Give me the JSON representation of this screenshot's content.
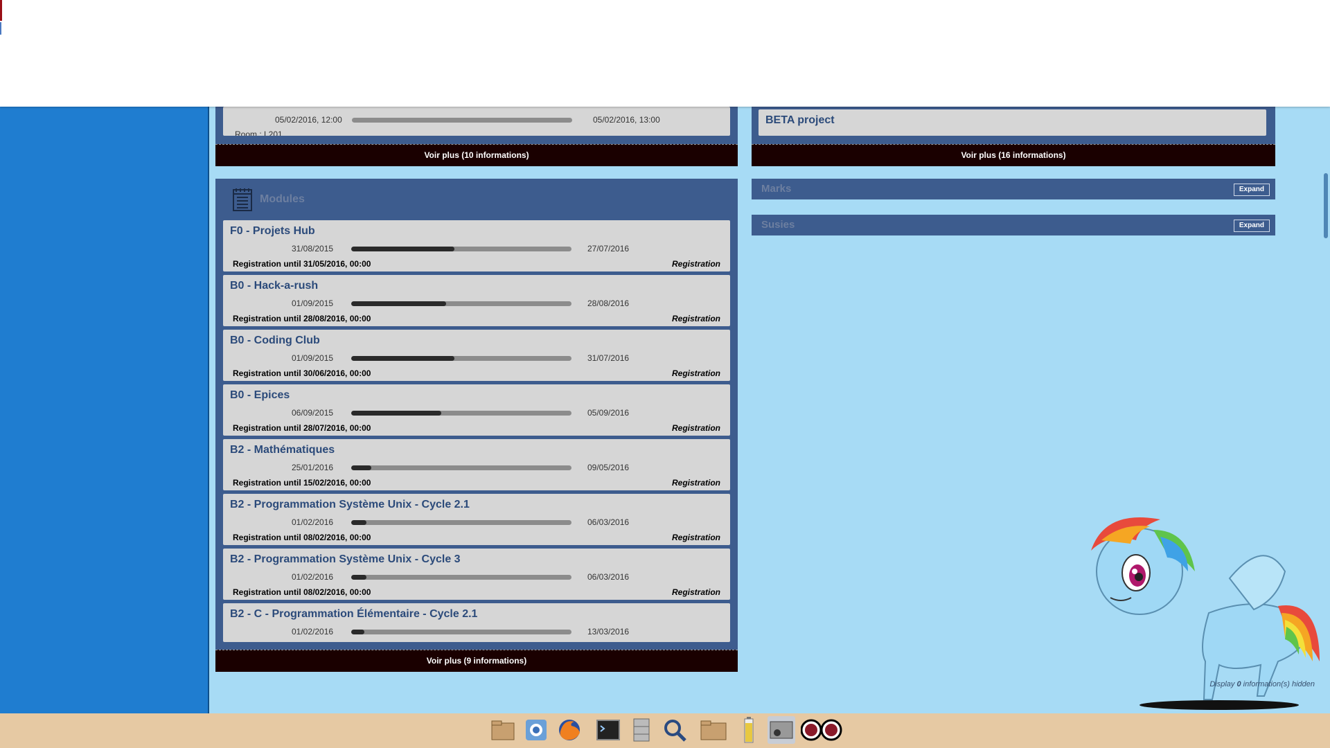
{
  "top_left_card": {
    "start": "05/02/2016, 12:00",
    "end": "05/02/2016, 13:00",
    "room": "Room : L201",
    "progress": 0.0
  },
  "left_more_label": "Voir plus (10 informations)",
  "right_top_card": {
    "title": "BETA project"
  },
  "right_more_label": "Voir plus (16 informations)",
  "modules": {
    "header": "Modules",
    "items": [
      {
        "title": "F0 - Projets Hub",
        "start": "31/08/2015",
        "end": "27/07/2016",
        "progress": 0.47,
        "registration": "Registration until 31/05/2016, 00:00",
        "action": "Registration"
      },
      {
        "title": "B0 - Hack-a-rush",
        "start": "01/09/2015",
        "end": "28/08/2016",
        "progress": 0.43,
        "registration": "Registration until 28/08/2016, 00:00",
        "action": "Registration"
      },
      {
        "title": "B0 - Coding Club",
        "start": "01/09/2015",
        "end": "31/07/2016",
        "progress": 0.47,
        "registration": "Registration until 30/06/2016, 00:00",
        "action": "Registration"
      },
      {
        "title": "B0 - Epices",
        "start": "06/09/2015",
        "end": "05/09/2016",
        "progress": 0.41,
        "registration": "Registration until 28/07/2016, 00:00",
        "action": "Registration"
      },
      {
        "title": "B2 - Mathématiques",
        "start": "25/01/2016",
        "end": "09/05/2016",
        "progress": 0.09,
        "registration": "Registration until 15/02/2016, 00:00",
        "action": "Registration"
      },
      {
        "title": "B2 - Programmation Système Unix - Cycle 2.1",
        "start": "01/02/2016",
        "end": "06/03/2016",
        "progress": 0.07,
        "registration": "Registration until 08/02/2016, 00:00",
        "action": "Registration"
      },
      {
        "title": "B2 - Programmation Système Unix - Cycle 3",
        "start": "01/02/2016",
        "end": "06/03/2016",
        "progress": 0.07,
        "registration": "Registration until 08/02/2016, 00:00",
        "action": "Registration"
      },
      {
        "title": "B2 - C - Programmation Élémentaire - Cycle 2.1",
        "start": "01/02/2016",
        "end": "13/03/2016",
        "progress": 0.06,
        "registration": "",
        "action": ""
      }
    ],
    "more_label": "Voir plus (9 informations)"
  },
  "marks_panel": {
    "title": "Marks",
    "expand_label": "Expand"
  },
  "susies_panel": {
    "title": "Susies",
    "expand_label": "Expand"
  },
  "footnote": {
    "prefix": "Display ",
    "count": "0",
    "suffix": " information(s) hidden"
  },
  "colors": {
    "background": "#a7dbf5",
    "sidebar": "#1f7dd0",
    "panel": "#3d5c8e",
    "more_bar": "#1a0000",
    "taskbar": "#e6c9a3"
  },
  "taskbar_icons": [
    "home-folder-icon",
    "chromium-icon",
    "firefox-icon",
    "terminal-icon",
    "file-cabinet-icon",
    "search-icon",
    "folder-icon",
    "battery-icon",
    "screenshot-icon",
    "eyes-icon"
  ]
}
